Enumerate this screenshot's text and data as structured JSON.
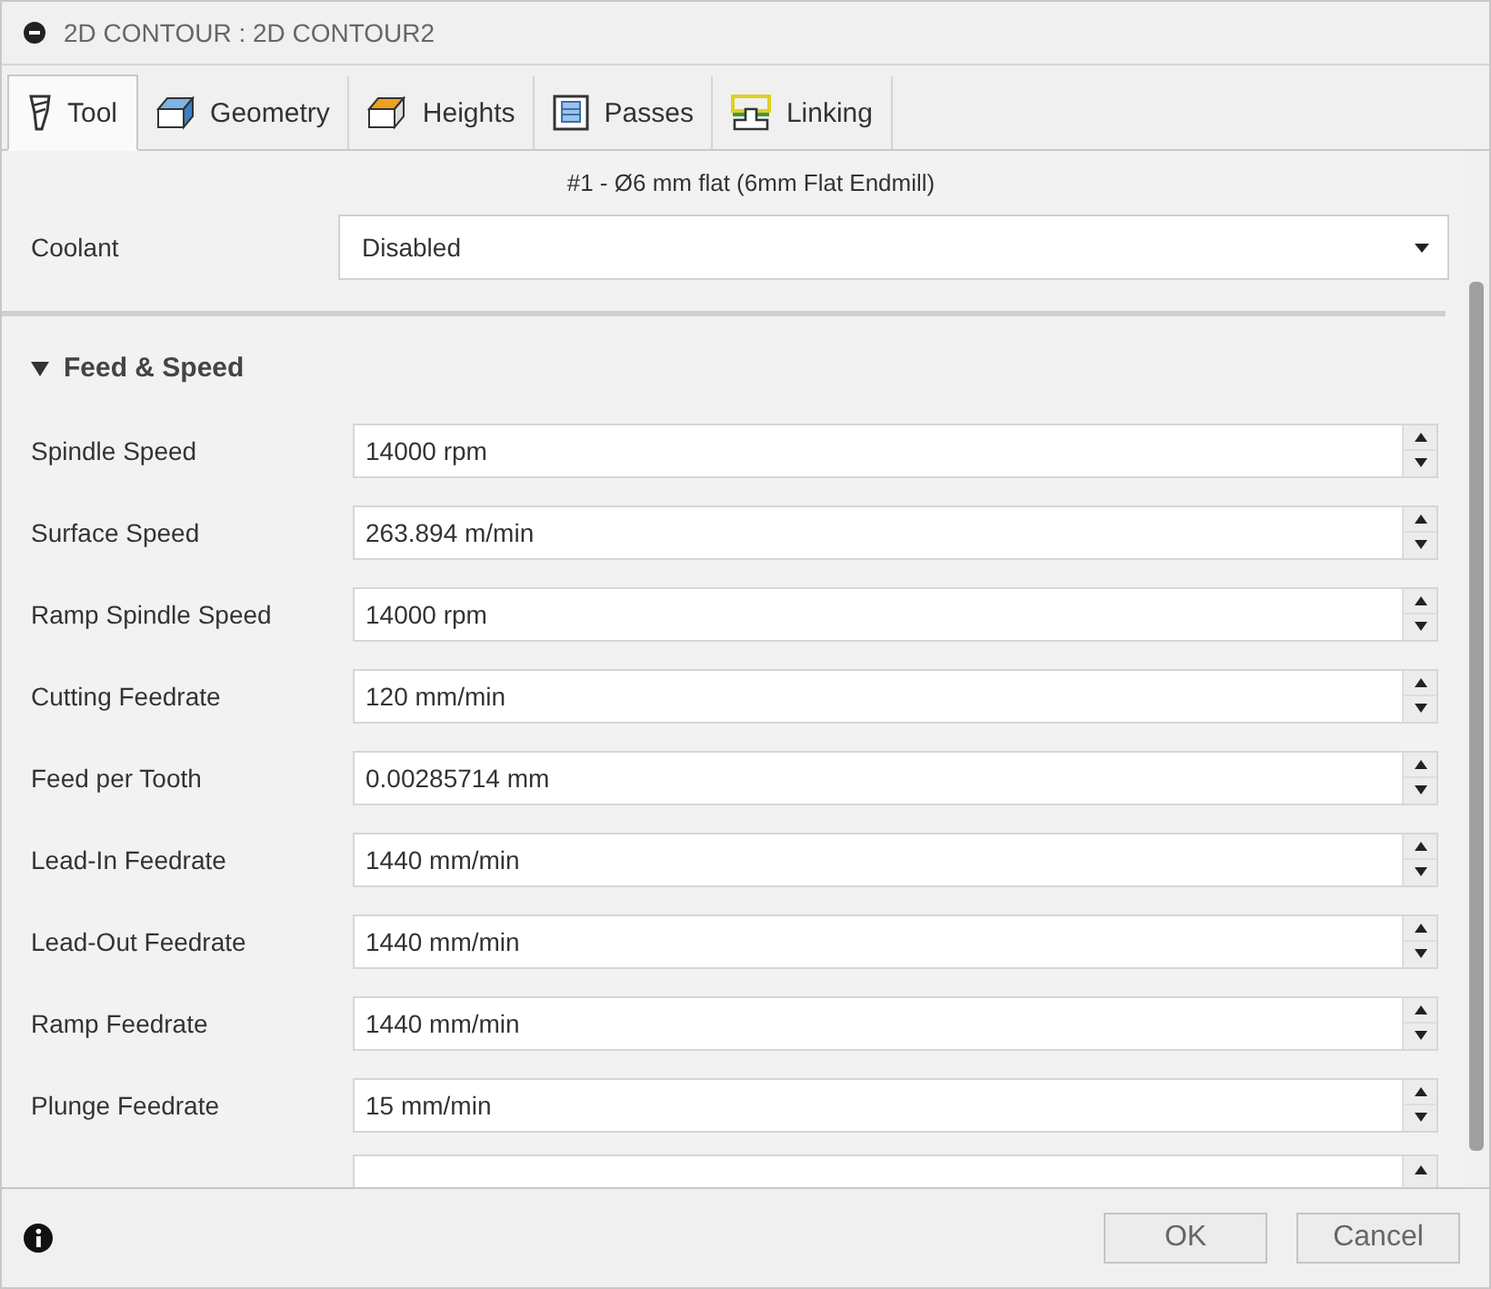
{
  "window": {
    "title": "2D CONTOUR : 2D CONTOUR2"
  },
  "tabs": [
    {
      "label": "Tool",
      "kind": "tool",
      "selected": true
    },
    {
      "label": "Geometry",
      "kind": "geometry",
      "selected": false
    },
    {
      "label": "Heights",
      "kind": "heights",
      "selected": false
    },
    {
      "label": "Passes",
      "kind": "passes",
      "selected": false
    },
    {
      "label": "Linking",
      "kind": "linking",
      "selected": false
    }
  ],
  "tool_description": "#1 - Ø6 mm flat (6mm Flat Endmill)",
  "coolant": {
    "label": "Coolant",
    "value": "Disabled"
  },
  "section": {
    "title": "Feed & Speed",
    "expanded": true
  },
  "fields": [
    {
      "label": "Spindle Speed",
      "value": "14000 rpm"
    },
    {
      "label": "Surface Speed",
      "value": "263.894 m/min"
    },
    {
      "label": "Ramp Spindle Speed",
      "value": "14000 rpm"
    },
    {
      "label": "Cutting Feedrate",
      "value": "120 mm/min"
    },
    {
      "label": "Feed per Tooth",
      "value": "0.00285714 mm"
    },
    {
      "label": "Lead-In Feedrate",
      "value": "1440 mm/min"
    },
    {
      "label": "Lead-Out Feedrate",
      "value": "1440 mm/min"
    },
    {
      "label": "Ramp Feedrate",
      "value": "1440 mm/min"
    },
    {
      "label": "Plunge Feedrate",
      "value": "15 mm/min"
    }
  ],
  "buttons": [
    "OK",
    "Cancel"
  ]
}
